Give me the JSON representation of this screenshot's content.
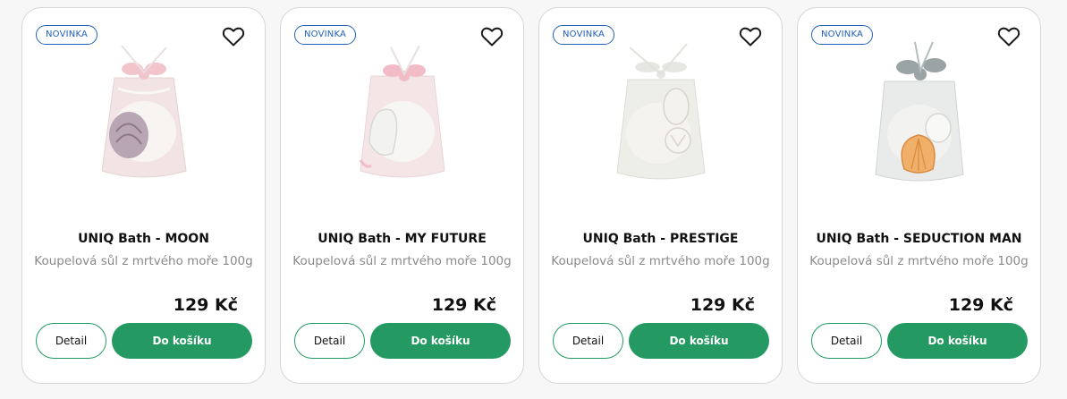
{
  "products": [
    {
      "badge": "NOVINKA",
      "title": "UNIQ Bath - MOON",
      "subtitle": "Koupelová sůl z mrtvého moře 100g",
      "price": "129 Kč",
      "detail_label": "Detail",
      "cart_label": "Do košíku",
      "ribbon_color": "#f2c4cc",
      "bag_color": "#f2e4e4",
      "shell_color": "#b8a6b4"
    },
    {
      "badge": "NOVINKA",
      "title": "UNIQ Bath - MY FUTURE",
      "subtitle": "Koupelová sůl z mrtvého moře 100g",
      "price": "129 Kč",
      "detail_label": "Detail",
      "cart_label": "Do košíku",
      "ribbon_color": "#f1bcc6",
      "bag_color": "#f4e6e6",
      "shell_color": "#f2f2f0"
    },
    {
      "badge": "NOVINKA",
      "title": "UNIQ Bath - PRESTIGE",
      "subtitle": "Koupelová sůl z mrtvého moře 100g",
      "price": "129 Kč",
      "detail_label": "Detail",
      "cart_label": "Do košíku",
      "ribbon_color": "#e6e6e2",
      "bag_color": "#eeeee8",
      "shell_color": "#f4f2ec"
    },
    {
      "badge": "NOVINKA",
      "title": "UNIQ Bath - SEDUCTION MAN",
      "subtitle": "Koupelová sůl z mrtvého moře 100g",
      "price": "129 Kč",
      "detail_label": "Detail",
      "cart_label": "Do košíku",
      "ribbon_color": "#9aa4a4",
      "bag_color": "#e9eaea",
      "shell_color": "#f0b06a"
    }
  ],
  "theme": {
    "accent": "#249a62",
    "badge": "#2160b8"
  },
  "icons": {
    "favorite": "heart-outline-icon"
  }
}
